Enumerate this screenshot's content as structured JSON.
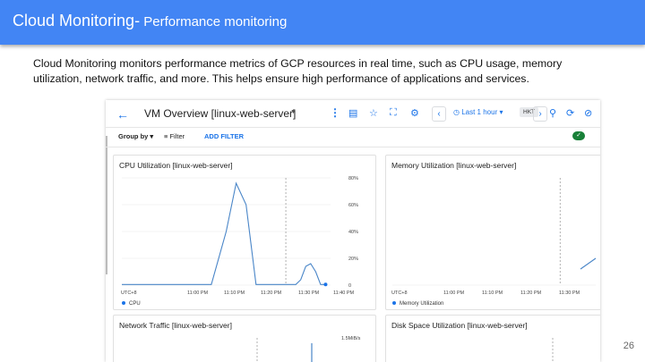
{
  "slide": {
    "title_main": "Cloud Monitoring-",
    "title_sub": " Performance monitoring",
    "description": "Cloud Monitoring monitors performance metrics of GCP resources in real time, such as CPU usage, memory utilization, network traffic, and more. This helps ensure high performance of applications and services.",
    "page_number": "26",
    "colors": {
      "title_bar": "#4285f4",
      "accent": "#1a73e8",
      "series": "#4a86c8"
    }
  },
  "console": {
    "back_icon": "arrow-left-icon",
    "page_title": "VM Overview [linux-web-server]",
    "toolbar_icons": [
      "more-vert-icon",
      "dashboard-icon",
      "star-icon",
      "fullscreen-icon",
      "settings-icon",
      "chevron-left-icon",
      "chevron-right-icon",
      "zoom-icon",
      "auto-refresh-off-icon"
    ],
    "time_range": "Last 1 hour",
    "timezone_badge": "HKT",
    "group_by": "Group by",
    "filter": "Filter",
    "add_filter": "ADD FILTER",
    "status_icon": "check-icon"
  },
  "chart_data": [
    {
      "type": "line",
      "title": "CPU Utilization [linux-web-server]",
      "x_ticks": [
        "UTC+8",
        "11:00 PM",
        "11:10 PM",
        "11:20 PM",
        "11:30 PM",
        "11:40 PM"
      ],
      "y_ticks": [
        "0",
        "20%",
        "40%",
        "60%",
        "80%"
      ],
      "ylim": [
        0,
        80
      ],
      "series": [
        {
          "name": "CPU",
          "x": [
            0,
            13,
            18,
            21,
            23,
            25,
            27,
            35,
            36,
            37,
            38,
            39,
            40,
            41
          ],
          "y": [
            0.5,
            0.5,
            0.5,
            40,
            76,
            60,
            0.5,
            0.5,
            4,
            14,
            16,
            10,
            0.5,
            0.5
          ]
        }
      ]
    },
    {
      "type": "line",
      "title": "Memory Utilization [linux-web-server]",
      "x_ticks": [
        "UTC+8",
        "11:00 PM",
        "11:10 PM",
        "11:20 PM",
        "11:30 PM"
      ],
      "series": [
        {
          "name": "Memory Utilization",
          "x": [
            37,
            40
          ],
          "y": [
            0.15,
            0.25
          ]
        }
      ]
    },
    {
      "type": "line",
      "title": "Network Traffic [linux-web-server]",
      "y_ticks": [
        "1.5MiB/s"
      ]
    },
    {
      "type": "line",
      "title": "Disk Space Utilization [linux-web-server]"
    }
  ]
}
